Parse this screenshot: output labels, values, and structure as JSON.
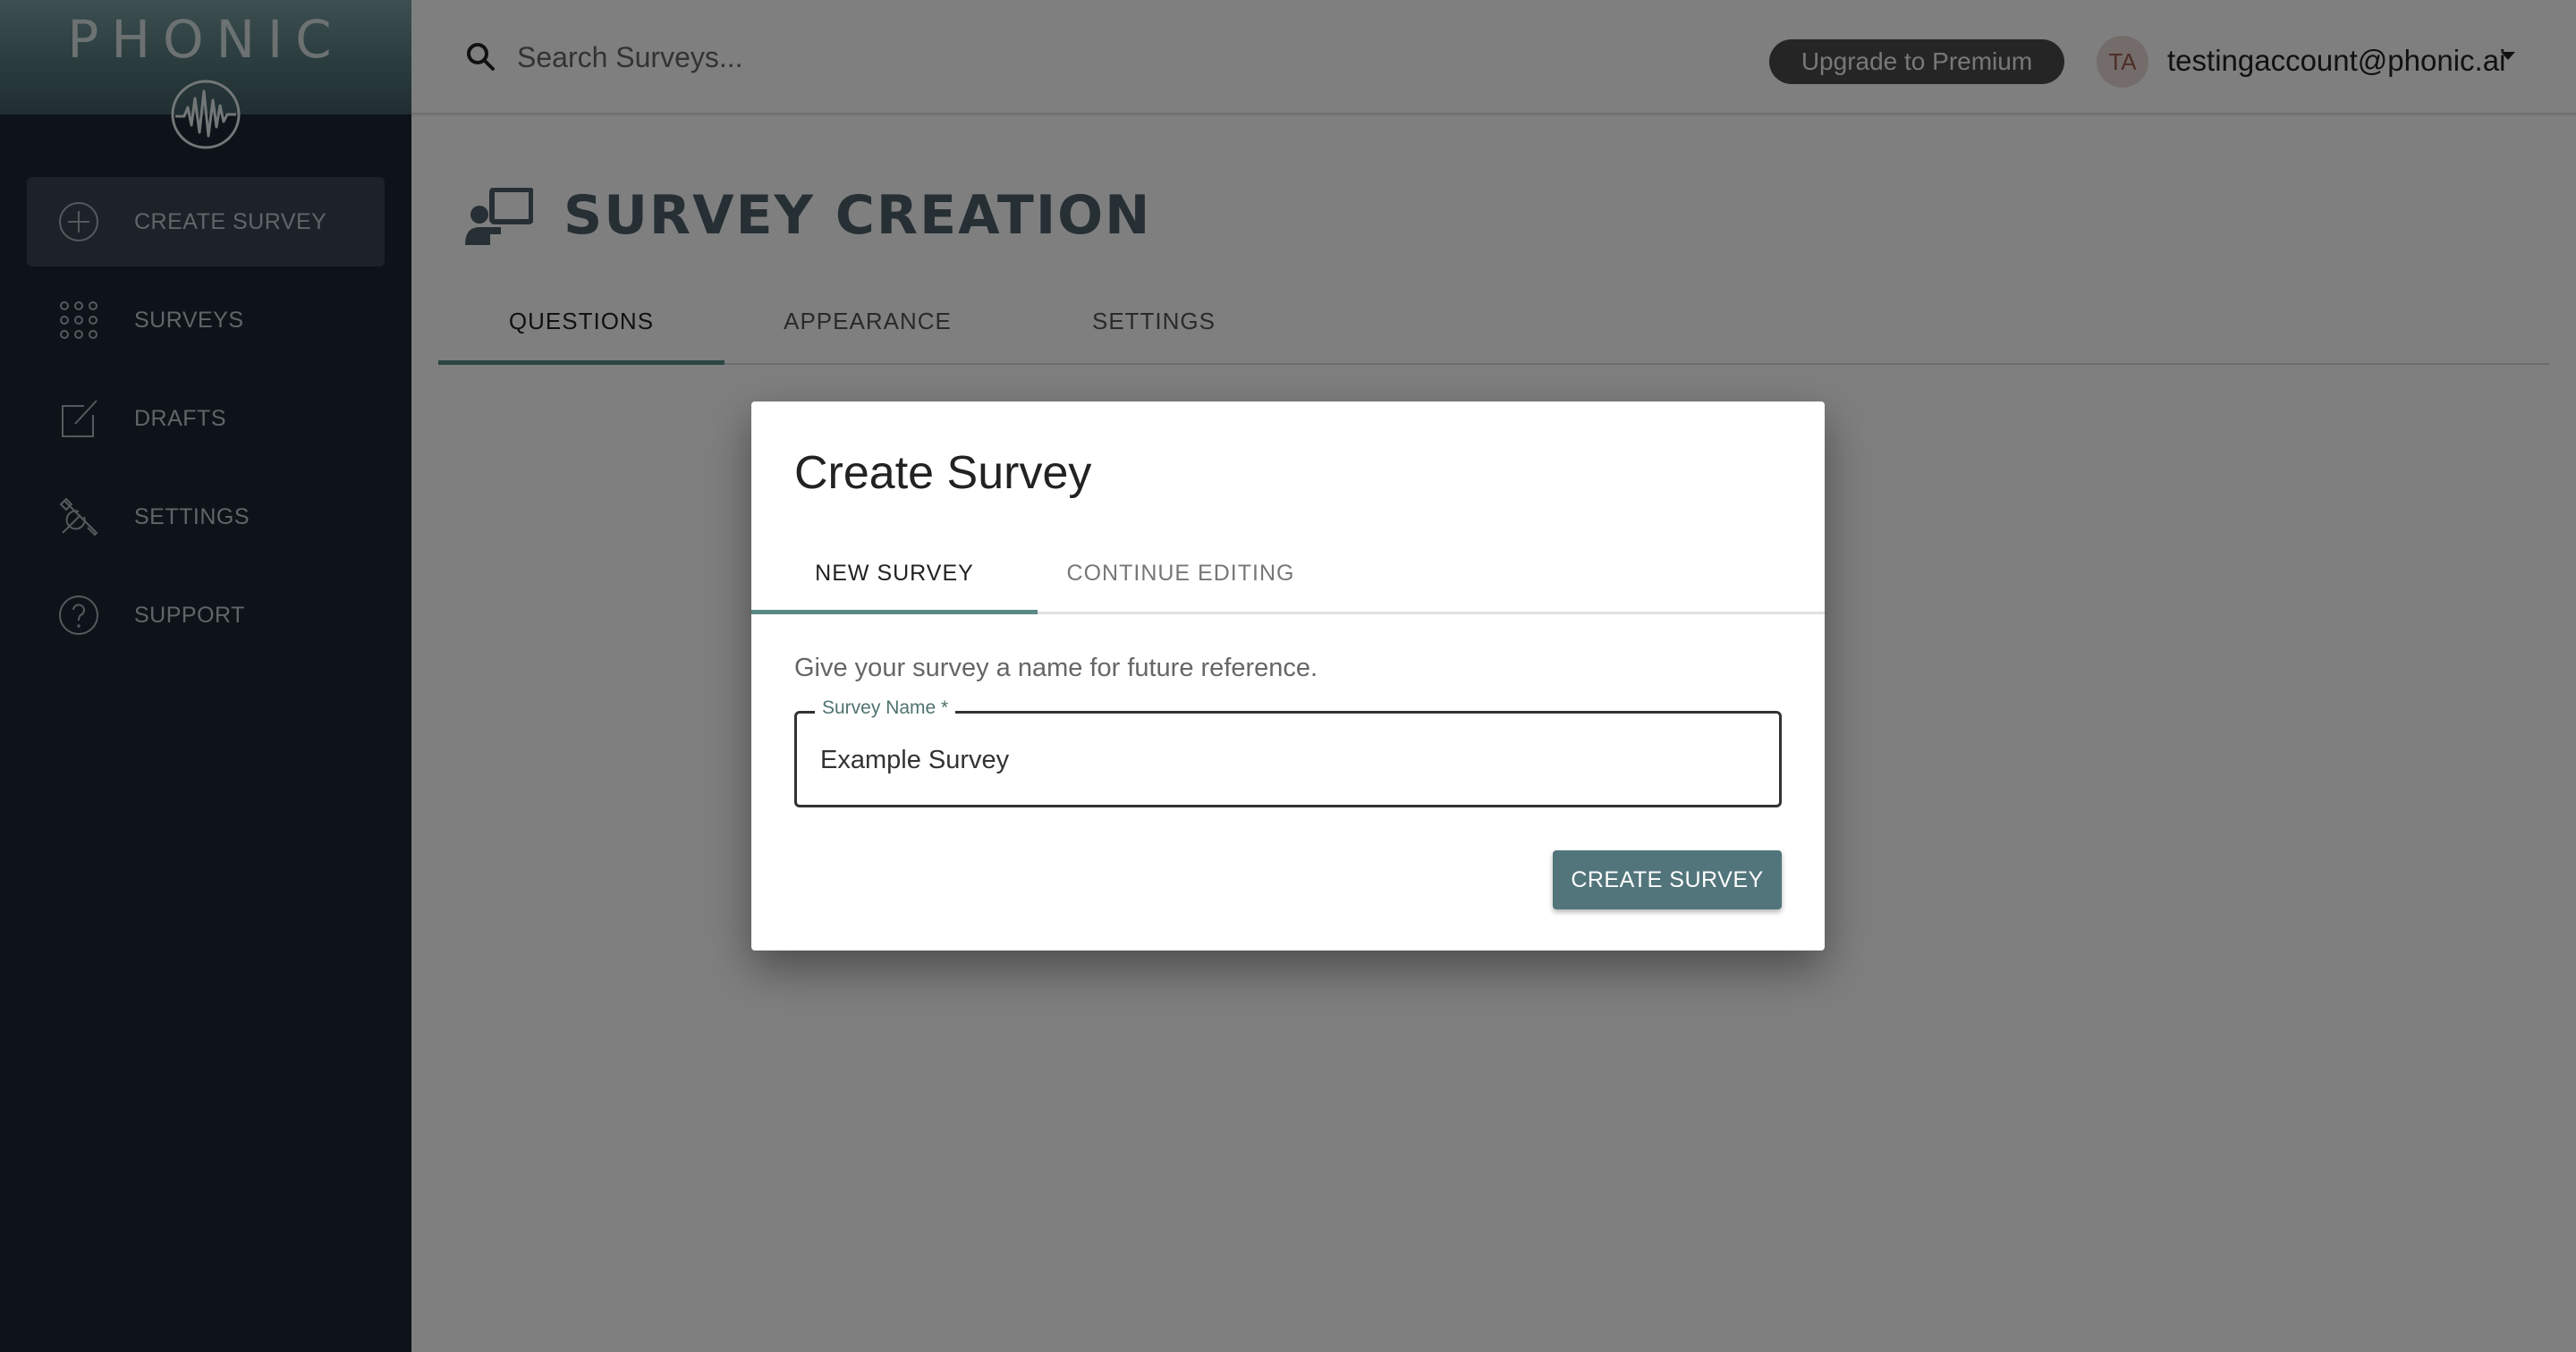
{
  "brand": {
    "name": "PHONIC"
  },
  "sidebar": {
    "items": [
      {
        "label": "CREATE SURVEY",
        "icon": "plus-circle-icon",
        "active": true
      },
      {
        "label": "SURVEYS",
        "icon": "grid-dots-icon"
      },
      {
        "label": "DRAFTS",
        "icon": "edit-icon"
      },
      {
        "label": "SETTINGS",
        "icon": "tools-icon"
      },
      {
        "label": "SUPPORT",
        "icon": "help-circle-icon"
      }
    ]
  },
  "header": {
    "search_placeholder": "Search Surveys...",
    "upgrade_label": "Upgrade to Premium",
    "avatar_initials": "TA",
    "user_email": "testingaccount@phonic.ai"
  },
  "page": {
    "title": "SURVEY CREATION",
    "tabs": [
      {
        "label": "QUESTIONS",
        "active": true
      },
      {
        "label": "APPEARANCE"
      },
      {
        "label": "SETTINGS"
      }
    ]
  },
  "modal": {
    "title": "Create Survey",
    "tabs": [
      {
        "label": "NEW SURVEY",
        "active": true
      },
      {
        "label": "CONTINUE EDITING"
      }
    ],
    "helper_text": "Give your survey a name for future reference.",
    "field_label": "Survey Name *",
    "field_value": "Example Survey",
    "submit_label": "CREATE SURVEY"
  },
  "colors": {
    "sidebar_bg": "#1c2632",
    "accent": "#5a8a86",
    "button": "#52757b"
  }
}
